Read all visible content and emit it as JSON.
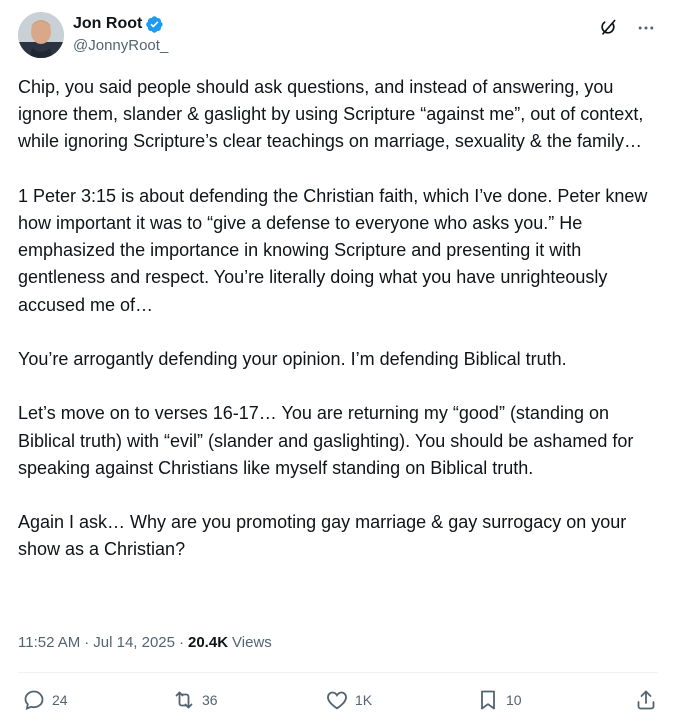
{
  "author": {
    "display_name": "Jon Root",
    "handle": "@JonnyRoot_",
    "verified_icon": "verified-badge-icon"
  },
  "top_actions": {
    "grok_icon": "grok-icon",
    "more_icon": "more-icon"
  },
  "post": {
    "paragraphs": [
      "Chip, you said people should ask questions, and instead of answering, you ignore them, slander & gaslight by using Scripture “against me”, out of context, while ignoring Scripture’s clear teachings on marriage, sexuality & the family…",
      "1 Peter 3:15 is about defending the Christian faith, which I’ve done. Peter knew how important it was to “give a defense to everyone who asks you.” He emphasized the importance in knowing Scripture and presenting it with gentleness and respect. You’re literally doing what you have unrighteously accused me of…",
      "You’re arrogantly defending your opinion. I’m defending Biblical truth.",
      "Let’s move on to verses 16-17… You are returning my “good” (standing on Biblical truth) with “evil” (slander and gaslighting). You should be ashamed for speaking against Christians like myself standing on Biblical truth.",
      "Again I ask… Why are you promoting gay marriage & gay surrogacy on your show as a Christian?"
    ]
  },
  "meta": {
    "time": "11:52 AM",
    "separator": "·",
    "date": "Jul 14, 2025",
    "views_count": "20.4K",
    "views_label": "Views"
  },
  "actions": {
    "replies": "24",
    "reposts": "36",
    "likes": "1K",
    "bookmarks": "10"
  },
  "colors": {
    "text": "#0f1419",
    "secondary": "#536471",
    "verified": "#1d9bf0",
    "divider": "#eff3f4"
  }
}
